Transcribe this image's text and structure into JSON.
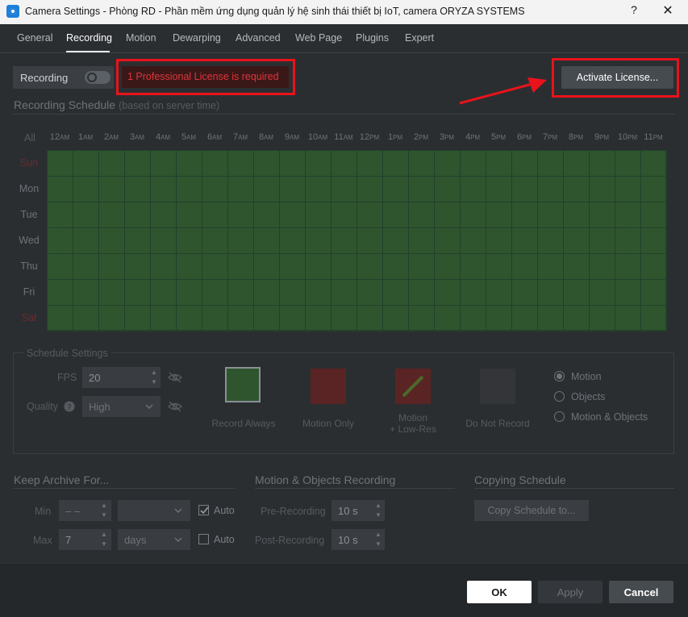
{
  "window": {
    "title": "Camera Settings - Phòng RD - Phần mềm ứng dụng quản lý hệ sinh thái thiết bị IoT, camera ORYZA SYSTEMS",
    "help_glyph": "?",
    "close_glyph": "✕"
  },
  "tabs": [
    {
      "label": "General"
    },
    {
      "label": "Recording"
    },
    {
      "label": "Motion"
    },
    {
      "label": "Dewarping"
    },
    {
      "label": "Advanced"
    },
    {
      "label": "Web Page"
    },
    {
      "label": "Plugins"
    },
    {
      "label": "Expert"
    }
  ],
  "active_tab": "Recording",
  "recording": {
    "toggle_label": "Recording",
    "enabled": false,
    "license_warning": "1 Professional License is required",
    "activate_label": "Activate License..."
  },
  "schedule": {
    "title": "Recording Schedule",
    "subtitle": "(based on server time)",
    "all_label": "All",
    "hours": [
      {
        "n": "12",
        "s": "AM"
      },
      {
        "n": "1",
        "s": "AM"
      },
      {
        "n": "2",
        "s": "AM"
      },
      {
        "n": "3",
        "s": "AM"
      },
      {
        "n": "4",
        "s": "AM"
      },
      {
        "n": "5",
        "s": "AM"
      },
      {
        "n": "6",
        "s": "AM"
      },
      {
        "n": "7",
        "s": "AM"
      },
      {
        "n": "8",
        "s": "AM"
      },
      {
        "n": "9",
        "s": "AM"
      },
      {
        "n": "10",
        "s": "AM"
      },
      {
        "n": "11",
        "s": "AM"
      },
      {
        "n": "12",
        "s": "PM"
      },
      {
        "n": "1",
        "s": "PM"
      },
      {
        "n": "2",
        "s": "PM"
      },
      {
        "n": "3",
        "s": "PM"
      },
      {
        "n": "4",
        "s": "PM"
      },
      {
        "n": "5",
        "s": "PM"
      },
      {
        "n": "6",
        "s": "PM"
      },
      {
        "n": "7",
        "s": "PM"
      },
      {
        "n": "8",
        "s": "PM"
      },
      {
        "n": "9",
        "s": "PM"
      },
      {
        "n": "10",
        "s": "PM"
      },
      {
        "n": "11",
        "s": "PM"
      }
    ],
    "days": [
      "Sun",
      "Mon",
      "Tue",
      "Wed",
      "Thu",
      "Fri",
      "Sat"
    ],
    "cell_color": "#2f552f"
  },
  "schedule_settings": {
    "title": "Schedule Settings",
    "fps_label": "FPS",
    "fps_value": "20",
    "quality_label": "Quality",
    "quality_value": "High",
    "modes": [
      {
        "label": "Record Always",
        "color": "#2f552f"
      },
      {
        "label": "Motion Only",
        "color": "#5a2424"
      },
      {
        "label": "Motion\n+ Low-Res",
        "color": "#5a2424"
      },
      {
        "label": "Do Not Record",
        "color": "#333538"
      }
    ],
    "radio_options": [
      "Motion",
      "Objects",
      "Motion & Objects"
    ],
    "radio_selected": "Motion"
  },
  "archive": {
    "title": "Keep Archive For...",
    "min_label": "Min",
    "min_value": "– –",
    "min_unit": "",
    "min_auto_label": "Auto",
    "min_auto_checked": true,
    "max_label": "Max",
    "max_value": "7",
    "max_unit": "days",
    "max_auto_label": "Auto",
    "max_auto_checked": false
  },
  "motion_rec": {
    "title": "Motion & Objects Recording",
    "pre_label": "Pre-Recording",
    "pre_value": "10 s",
    "post_label": "Post-Recording",
    "post_value": "10 s"
  },
  "copying": {
    "title": "Copying Schedule",
    "button_label": "Copy Schedule to..."
  },
  "footer": {
    "ok_label": "OK",
    "apply_label": "Apply",
    "cancel_label": "Cancel"
  },
  "annotations": {
    "highlight_color": "#e8131b"
  }
}
